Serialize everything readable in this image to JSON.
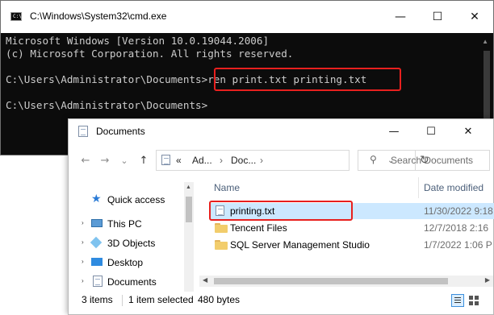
{
  "cmd": {
    "title": "C:\\Windows\\System32\\cmd.exe",
    "lines": [
      "Microsoft Windows [Version 10.0.19044.2006]",
      "(c) Microsoft Corporation. All rights reserved.",
      "",
      "C:\\Users\\Administrator\\Documents>ren print.txt printing.txt",
      "",
      "C:\\Users\\Administrator\\Documents>"
    ],
    "controls": {
      "minimize": "—",
      "maximize": "☐",
      "close": "✕"
    }
  },
  "explorer": {
    "title": "Documents",
    "controls": {
      "minimize": "—",
      "maximize": "☐",
      "close": "✕"
    },
    "nav": {
      "back": "←",
      "forward": "→",
      "recent": "⌄",
      "up": "↑"
    },
    "address": {
      "overflow": "«",
      "segments": [
        "Ad...",
        "Doc..."
      ],
      "separator": "›",
      "refresh": "↻"
    },
    "search": {
      "placeholder": "Search Documents"
    },
    "sidebar": [
      {
        "label": "Quick access",
        "icon": "star-icon"
      },
      {
        "label": "This PC",
        "icon": "computer-icon"
      },
      {
        "label": "3D Objects",
        "icon": "cube-icon"
      },
      {
        "label": "Desktop",
        "icon": "desktop-icon"
      },
      {
        "label": "Documents",
        "icon": "documents-icon"
      }
    ],
    "columns": {
      "name": "Name",
      "date": "Date modified"
    },
    "files": [
      {
        "name": "printing.txt",
        "date": "11/30/2022 9:18",
        "type": "text-file",
        "selected": true
      },
      {
        "name": "Tencent Files",
        "date": "12/7/2018 2:16",
        "type": "folder",
        "selected": false
      },
      {
        "name": "SQL Server Management Studio",
        "date": "1/7/2022 1:06 P",
        "type": "folder",
        "selected": false
      }
    ],
    "status": {
      "items": "3 items",
      "selected": "1 item selected",
      "size": "480 bytes"
    },
    "colors": {
      "selection": "#cce8ff",
      "highlight_box": "#e8201e",
      "cmd_background": "#0c0c0c",
      "cmd_text": "#cccccc"
    }
  }
}
